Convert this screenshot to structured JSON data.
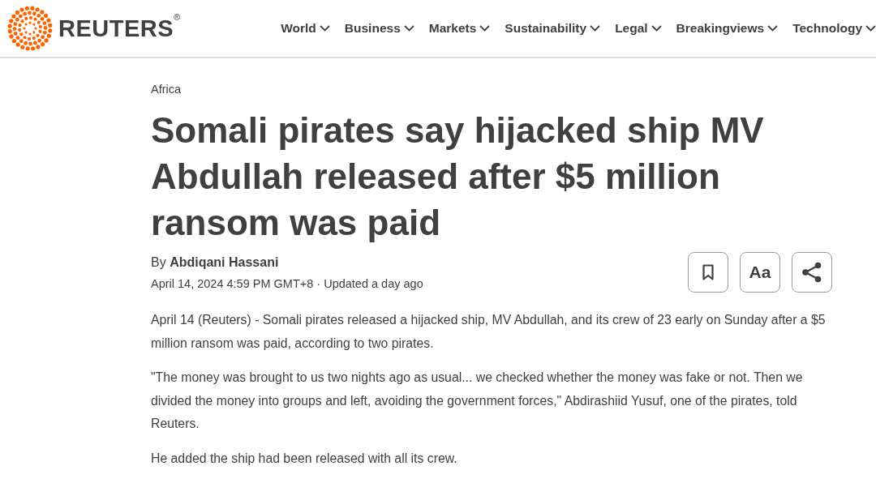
{
  "header": {
    "logo": "REUTERS$^{®}$",
    "nav": [
      {
        "label": "World"
      },
      {
        "label": "Business"
      },
      {
        "label": "Markets"
      },
      {
        "label": "Sustainability"
      },
      {
        "label": "Legal"
      },
      {
        "label": "Breakingviews"
      },
      {
        "label": "Technology"
      }
    ]
  },
  "article": {
    "category": "Africa",
    "title": "Somali pirates say hijacked ship MV Abdullah released after $5 million ransom was paid",
    "byline": "By **Abdiqani Hassani**",
    "date": "April 14, 2024 4:59 PM GMT+8 · Updated a day ago",
    "tools": [
      {
        "kind": "bookmark"
      },
      {
        "kind": "text",
        "label": "Aa"
      },
      {
        "kind": "share"
      }
    ],
    "paragraphs": [
      "April 14 (Reuters) - Somali pirates released a hijacked ship, MV Abdullah, and its crew of 23 early on Sunday after a $5 million ransom was paid, according to two pirates.",
      "\"The money was brought to us two nights ago as usual... we checked whether the money was fake or not. Then we divided the money into groups and left, avoiding the government forces,\" Abdirashiid Yusuf, one of the pirates, told Reuters.",
      "He added the ship had been released with all its crew."
    ]
  }
}
